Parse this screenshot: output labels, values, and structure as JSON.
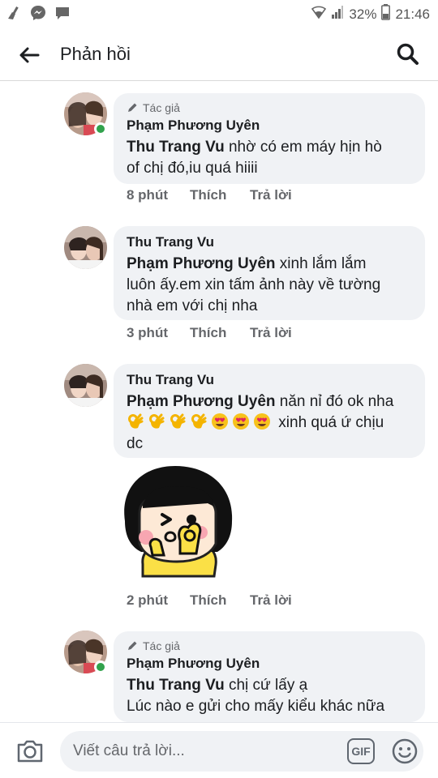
{
  "status_bar": {
    "battery_percent": "32%",
    "time": "21:46",
    "left_icons": [
      "broom-icon",
      "messenger-icon",
      "chat-bubble-icon"
    ],
    "right_icons": [
      "wifi-icon",
      "signal-icon",
      "battery-icon"
    ]
  },
  "header": {
    "title": "Phản hồi"
  },
  "comments": [
    {
      "author_badge": "Tác giả",
      "name": "Phạm Phương Uyên",
      "mention": "Thu Trang Vu",
      "text_line1": " nhờ có em máy hịn hò",
      "text_line2": "of chị đó,iu quá hiiii",
      "time": "8 phút",
      "like": "Thích",
      "reply": "Trả lời",
      "online": true
    },
    {
      "name": "Thu Trang Vu",
      "mention": "Phạm Phương Uyên",
      "text_line1": " xinh lắm lắm",
      "text_line2": "luôn ấy.em xin tấm ảnh này về tường",
      "text_line3": "nhà em với chị nha",
      "time": "3 phút",
      "like": "Thích",
      "reply": "Trả lời"
    },
    {
      "name": "Thu Trang Vu",
      "mention": "Phạm Phương Uyên",
      "text_line1": "  năn nỉ đó ok nha",
      "emoji_text": " xinh quá ứ chịu",
      "text_line3": "dc",
      "time": "2 phút",
      "like": "Thích",
      "reply": "Trả lời",
      "emojis": [
        "ok-hand",
        "ok-hand",
        "ok-hand",
        "ok-hand",
        "heart-eyes",
        "heart-eyes",
        "heart-eyes"
      ]
    },
    {
      "author_badge": "Tác giả",
      "name": "Phạm Phương Uyên",
      "mention": "Thu Trang Vu",
      "text_line1": " chị cứ lấy ạ",
      "text_line2": "Lúc nào e gửi cho mấy kiểu khác nữa",
      "online": true
    }
  ],
  "composer": {
    "placeholder": "Viết câu trả lời...",
    "gif_label": "GIF"
  },
  "colors": {
    "bubble": "#f0f2f5",
    "online": "#31a24c",
    "secondary_text": "#65676b"
  }
}
